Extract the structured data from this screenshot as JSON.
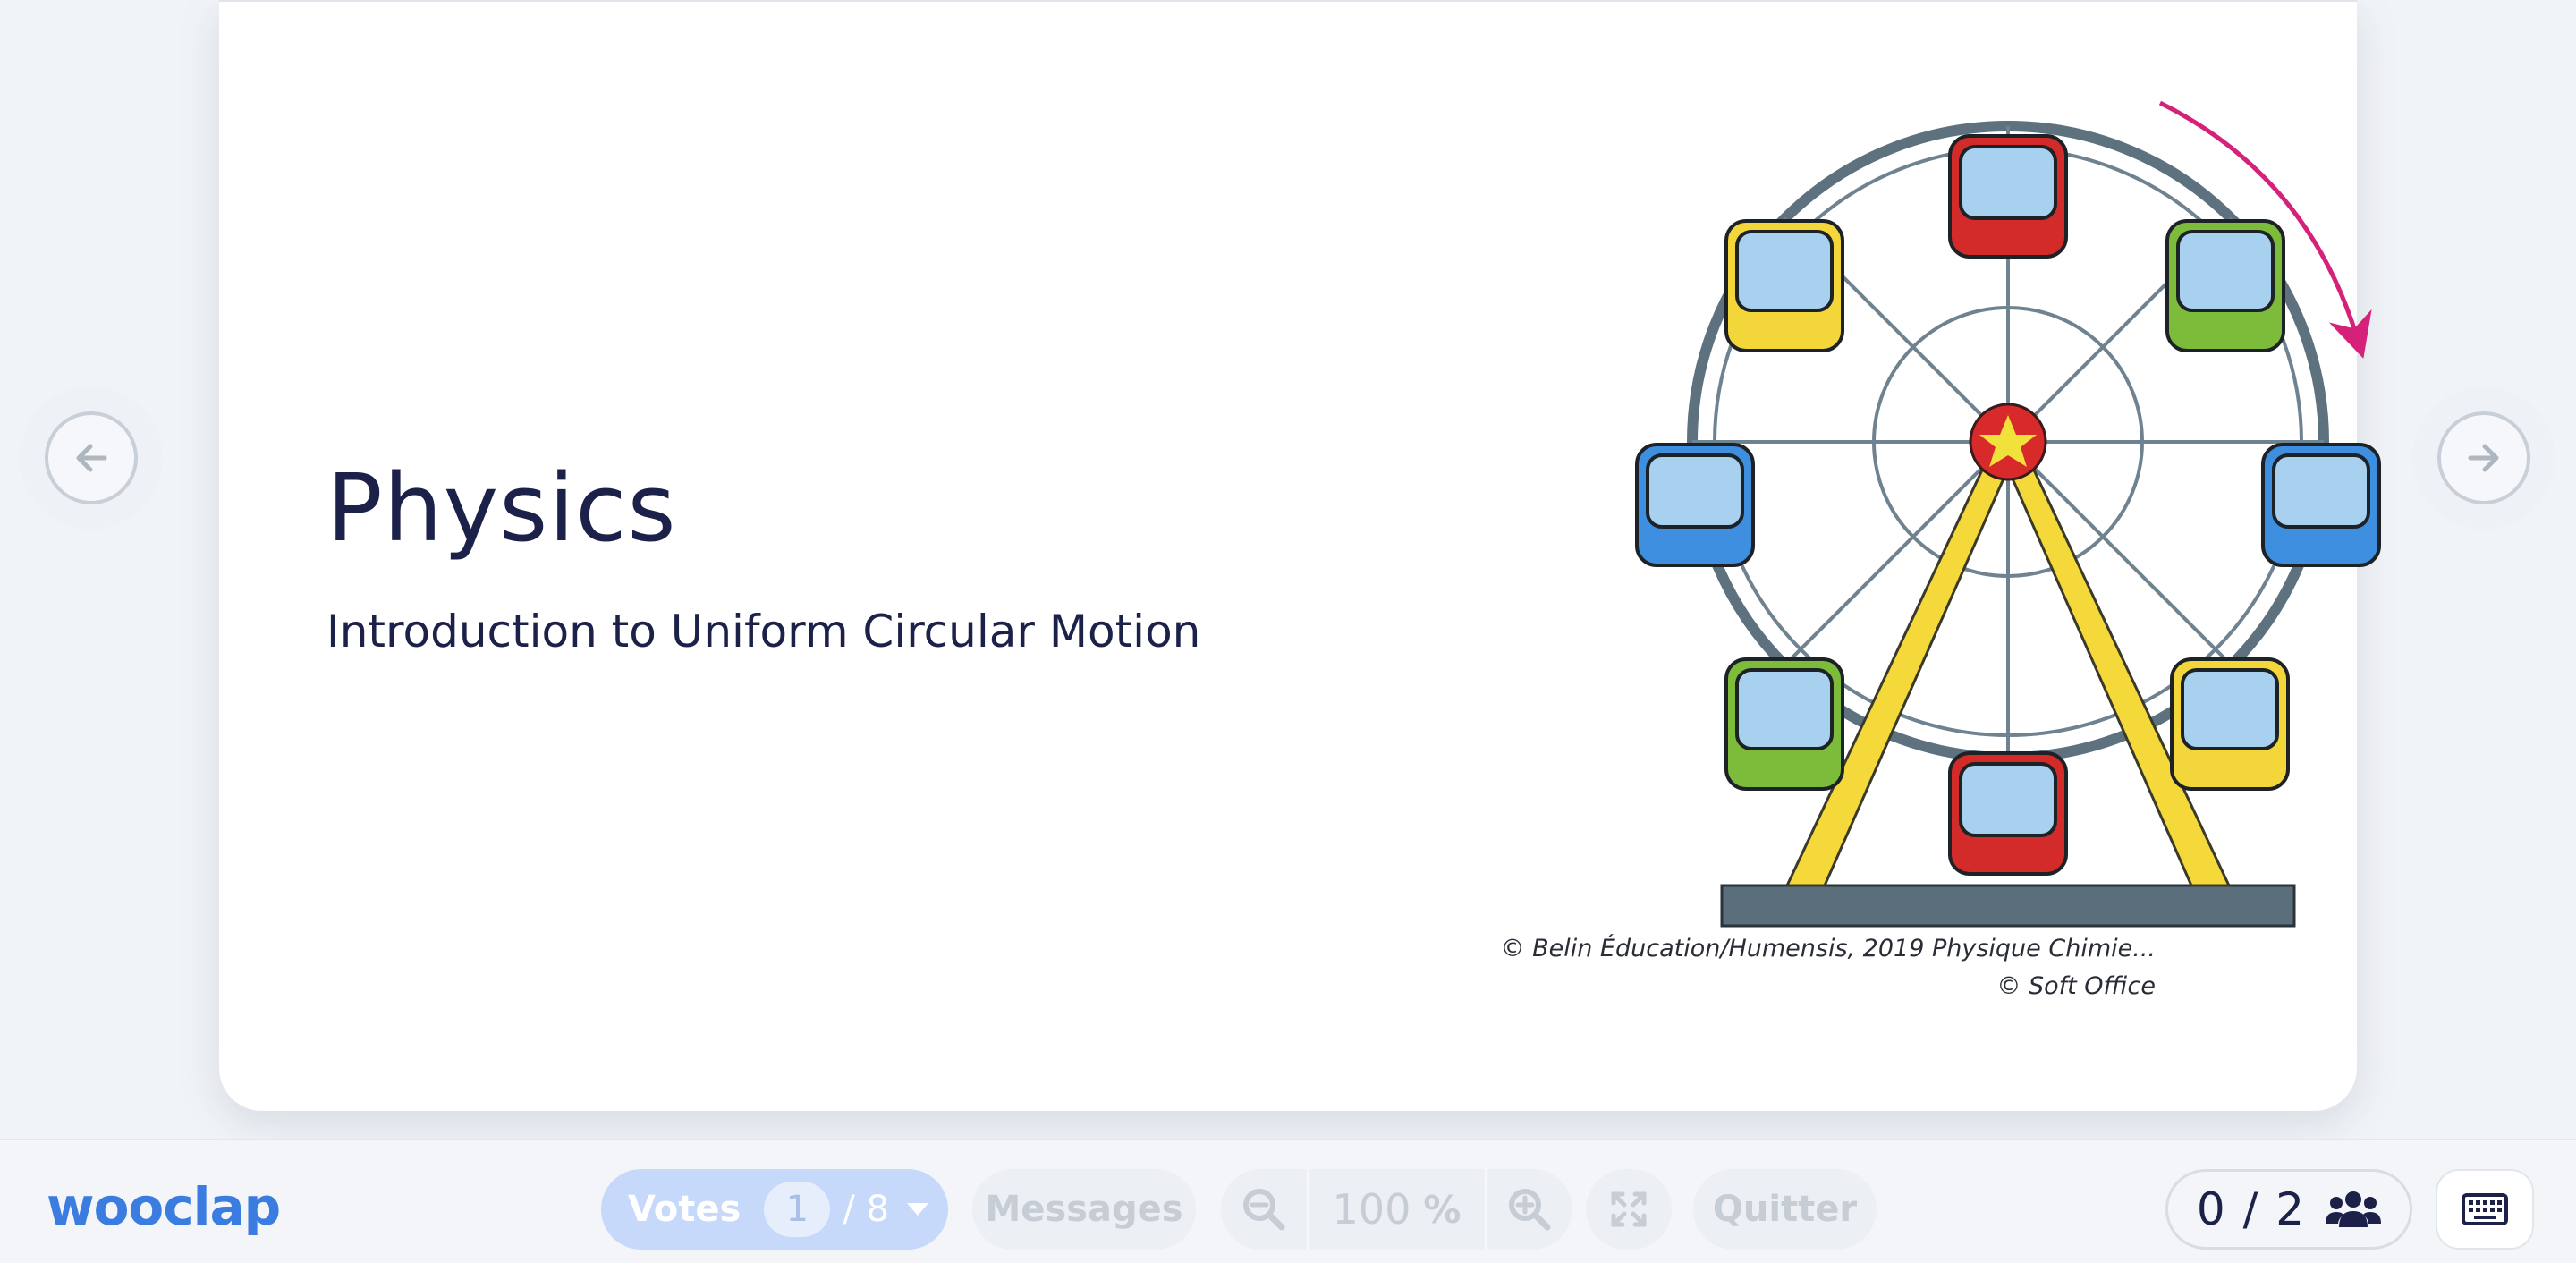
{
  "slide": {
    "title": "Physics",
    "subtitle": "Introduction to Uniform Circular Motion",
    "image": {
      "icon": "ferris-wheel-illustration",
      "credit_line_1": "© Belin Éducation/Humensis, 2019 Physique Chimie...",
      "credit_line_2": "© Soft Office"
    }
  },
  "navigation": {
    "prev_icon": "arrow-left-icon",
    "next_icon": "arrow-right-icon"
  },
  "toolbar": {
    "logo": "wooclap",
    "votes": {
      "label": "Votes",
      "current_page": "1",
      "total": "/ 8"
    },
    "messages_label": "Messages",
    "zoom": {
      "value": "100",
      "unit": "%"
    },
    "quit_label": "Quitter",
    "participants": {
      "count": "0 / 2"
    }
  },
  "colors": {
    "accent": "#3b7ce0",
    "votes_pill": "#c6d9fb",
    "title_text": "#1c2149",
    "arrow_magenta": "#d6217a"
  }
}
